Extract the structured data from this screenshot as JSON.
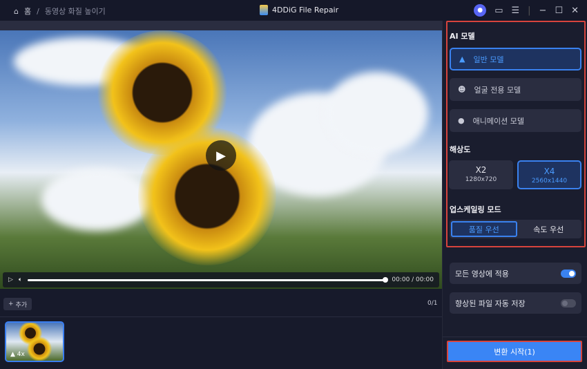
{
  "breadcrumb": {
    "home": "홈",
    "separator": "/",
    "current": "동영상 화질 높이기"
  },
  "app": {
    "title": "4DDiG File Repair"
  },
  "player": {
    "time": "00:00 / 00:00",
    "progress": 1.0
  },
  "list": {
    "add_label": "추가",
    "count": "0/1",
    "thumb_label": "4x"
  },
  "panel": {
    "ai_model_title": "AI 모델",
    "models": [
      "일반 모델",
      "얼굴 전용 모델",
      "애니메이션 모델"
    ],
    "resolution_title": "해상도",
    "resolutions": [
      {
        "label": "X2",
        "size": "1280x720"
      },
      {
        "label": "X4",
        "size": "2560x1440"
      }
    ],
    "upscale_title": "업스케일링 모드",
    "modes": [
      "품질 우선",
      "속도 우선"
    ],
    "apply_all": "모든 영상에 적용",
    "apply_all_on": true,
    "auto_save": "향상된 파일 자동 저장",
    "auto_save_on": false,
    "start": "변환 시작(1)"
  },
  "colors": {
    "accent": "#3a85f5",
    "highlight": "#d8443d"
  }
}
